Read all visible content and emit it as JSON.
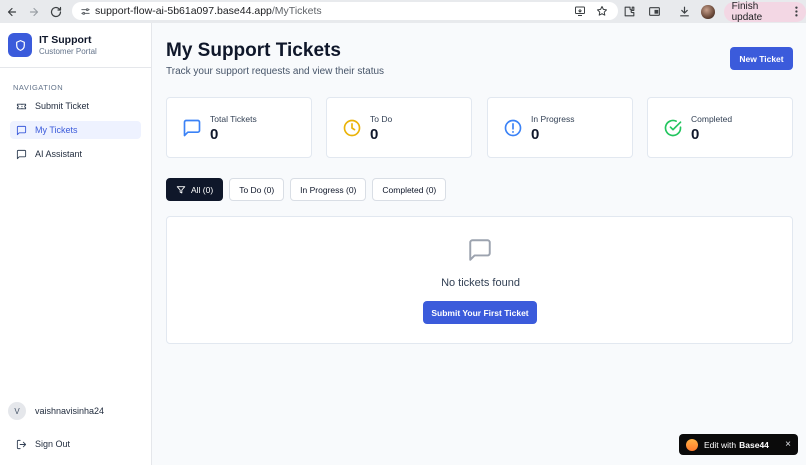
{
  "browser": {
    "url_domain": "support-flow-ai-5b61a097.base44.app",
    "url_path": "/MyTickets",
    "finish_update_label": "Finish update",
    "icons": [
      "back-icon",
      "forward-icon",
      "reload-icon",
      "site-settings-icon",
      "install-app-icon",
      "bookmark-star-icon",
      "extensions-icon",
      "cast-icon",
      "download-icon",
      "profile-avatar",
      "kebab-menu-icon"
    ]
  },
  "sidebar": {
    "brand_title": "IT Support",
    "brand_subtitle": "Customer Portal",
    "nav_heading": "Navigation",
    "items": [
      {
        "label": "Submit Ticket",
        "icon": "ticket-icon",
        "active": false
      },
      {
        "label": "My Tickets",
        "icon": "message-square-icon",
        "active": true
      },
      {
        "label": "AI Assistant",
        "icon": "message-square-icon",
        "active": false
      }
    ],
    "user_initial": "V",
    "user_name": "vaishnavisinha24",
    "sign_out_label": "Sign Out"
  },
  "main": {
    "title": "My Support Tickets",
    "subtitle": "Track your support requests and view their status",
    "new_ticket_label": "New Ticket",
    "stats": [
      {
        "label": "Total Tickets",
        "value": "0",
        "icon": "message-square-icon",
        "color": "#3b82f6"
      },
      {
        "label": "To Do",
        "value": "0",
        "icon": "clock-icon",
        "color": "#eab308"
      },
      {
        "label": "In Progress",
        "value": "0",
        "icon": "alert-circle-icon",
        "color": "#3b82f6"
      },
      {
        "label": "Completed",
        "value": "0",
        "icon": "check-circle-icon",
        "color": "#22c55e"
      }
    ],
    "filters": [
      {
        "label": "All (0)",
        "active": true
      },
      {
        "label": "To Do (0)",
        "active": false
      },
      {
        "label": "In Progress (0)",
        "active": false
      },
      {
        "label": "Completed (0)",
        "active": false
      }
    ],
    "empty_state": {
      "message": "No tickets found",
      "button_label": "Submit Your First Ticket"
    }
  },
  "badge": {
    "edit_with": "Edit with",
    "brand": "Base44",
    "close": "×"
  },
  "colors": {
    "accent": "#3b5bdb",
    "dark": "#0f172a",
    "active_nav_bg": "#eef2ff"
  }
}
